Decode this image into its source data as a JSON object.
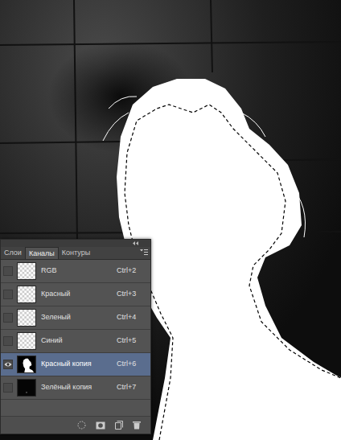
{
  "panel": {
    "tabs": [
      {
        "label": "Слои",
        "selected": false
      },
      {
        "label": "Каналы",
        "selected": true
      },
      {
        "label": "Контуры",
        "selected": false
      }
    ],
    "channels": [
      {
        "name": "RGB",
        "shortcut": "Ctrl+2",
        "visible": false,
        "selected": false,
        "thumbnail": "transparent"
      },
      {
        "name": "Красный",
        "shortcut": "Ctrl+3",
        "visible": false,
        "selected": false,
        "thumbnail": "transparent"
      },
      {
        "name": "Зеленый",
        "shortcut": "Ctrl+4",
        "visible": false,
        "selected": false,
        "thumbnail": "transparent"
      },
      {
        "name": "Синий",
        "shortcut": "Ctrl+5",
        "visible": false,
        "selected": false,
        "thumbnail": "transparent"
      },
      {
        "name": "Красный копия",
        "shortcut": "Ctrl+6",
        "visible": true,
        "selected": true,
        "thumbnail": "silhouette"
      },
      {
        "name": "Зелёный копия",
        "shortcut": "Ctrl+7",
        "visible": false,
        "selected": false,
        "thumbnail": "dark"
      }
    ]
  }
}
